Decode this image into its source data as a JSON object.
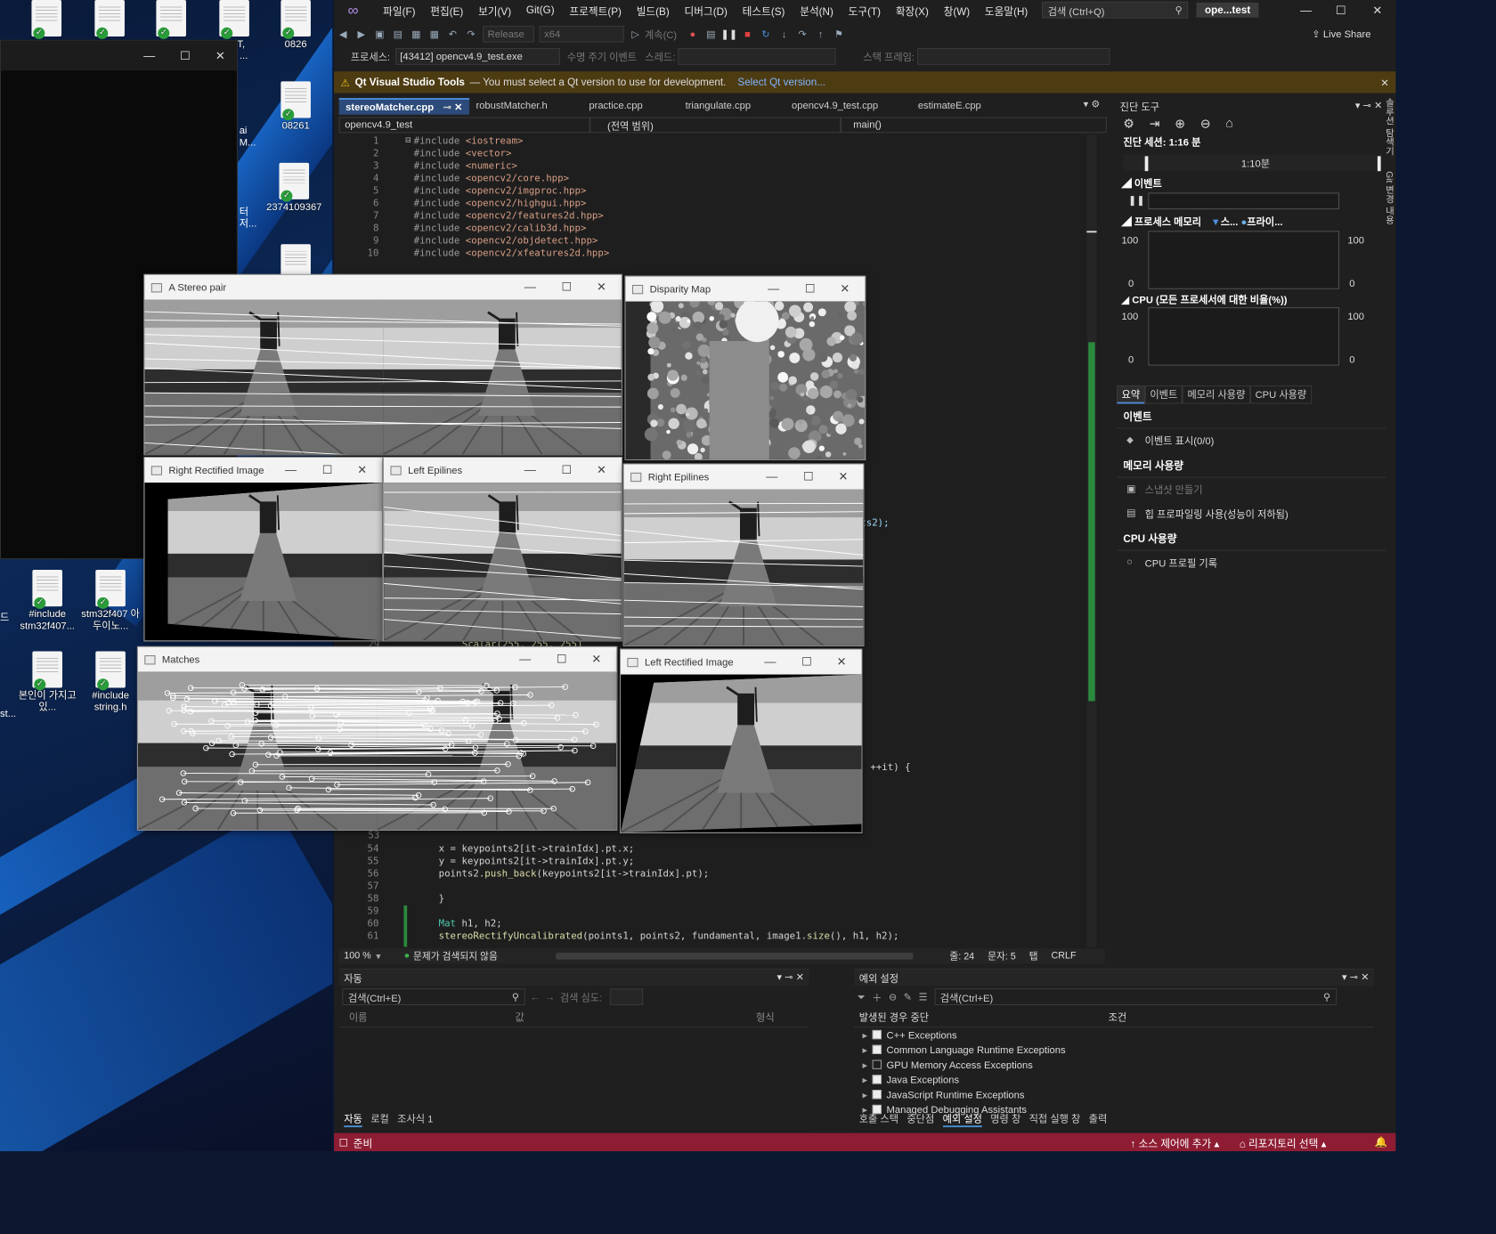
{
  "desktop": {
    "icons": [
      {
        "label": ""
      },
      {
        "label": ""
      },
      {
        "label": ""
      },
      {
        "label": "ART,\nSPI ..."
      },
      {
        "label": "0826"
      },
      {
        "label": "08261"
      },
      {
        "label": "2374109367"
      },
      {
        "label": "#include stm32f407..."
      },
      {
        "label": "stm32f407 아두이노..."
      },
      {
        "label": "본인이 가지고있..."
      },
      {
        "label": "#include string.h"
      }
    ],
    "partial_labels": [
      "ai",
      "M...",
      "터",
      "저...",
      "드",
      "st..."
    ]
  },
  "vs": {
    "menu": [
      "파일(F)",
      "편집(E)",
      "보기(V)",
      "Git(G)",
      "프로젝트(P)",
      "빌드(B)",
      "디버그(D)",
      "테스트(S)",
      "분석(N)",
      "도구(T)",
      "확장(X)",
      "창(W)",
      "도움말(H)"
    ],
    "search_placeholder": "검색 (Ctrl+Q)",
    "solution_title": "ope...test",
    "toolbar": {
      "config": "Release",
      "platform": "x64",
      "continue": "계속(C)",
      "live_share": "Live Share"
    },
    "toolbar2": {
      "process_label": "프로세스:",
      "process_value": "[43412] opencv4.9_test.exe",
      "lifecycle": "수명 주기 이벤트",
      "thread": "스레드:",
      "stack": "스택 프레임:"
    },
    "infobar": {
      "title": "Qt Visual Studio Tools",
      "message": "— You must select a Qt version to use for development.",
      "link": "Select Qt version..."
    },
    "tabs": [
      "stereoMatcher.cpp",
      "robustMatcher.h",
      "practice.cpp",
      "triangulate.cpp",
      "opencv4.9_test.cpp",
      "estimateE.cpp"
    ],
    "nav": {
      "project": "opencv4.9_test",
      "scope": "(전역 범위)",
      "function": "main()"
    },
    "code_top": [
      {
        "n": "1",
        "t": "#include <iostream>"
      },
      {
        "n": "2",
        "t": "#include <vector>"
      },
      {
        "n": "3",
        "t": "#include <numeric>"
      },
      {
        "n": "4",
        "t": "#include <opencv2/core.hpp>"
      },
      {
        "n": "5",
        "t": "#include <opencv2/imgproc.hpp>"
      },
      {
        "n": "6",
        "t": "#include <opencv2/highgui.hpp>"
      },
      {
        "n": "7",
        "t": "#include <opencv2/features2d.hpp>"
      },
      {
        "n": "8",
        "t": "#include <opencv2/calib3d.hpp>"
      },
      {
        "n": "9",
        "t": "#include <opencv2/objdetect.hpp>"
      },
      {
        "n": "10",
        "t": "#include <opencv2/xfeatures2d.hpp>"
      }
    ],
    "code_bottom": [
      {
        "n": "54",
        "t": "x = keypoints2[it->trainIdx].pt.x;"
      },
      {
        "n": "55",
        "t": "y = keypoints2[it->trainIdx].pt.y;"
      },
      {
        "n": "56",
        "t": "points2.push_back(keypoints2[it->trainIdx].pt);"
      },
      {
        "n": "57",
        "t": ""
      },
      {
        "n": "58",
        "t": "}"
      },
      {
        "n": "59",
        "t": ""
      },
      {
        "n": "60",
        "t": "Mat h1, h2;"
      },
      {
        "n": "61",
        "t": "stereoRectifyUncalibrated(points1, points2, fundamental, image1.size(), h1, h2);"
      }
    ],
    "code_fragments": {
      "points2": "points2);",
      "scalar": "Scalar(255, 255, 255)",
      "line29": "29",
      "loop": "nd(); ++it) {",
      "ln53": "53"
    },
    "status_line": {
      "zoom": "100 %",
      "issues": "문제가 검색되지 않음",
      "line": "줄: 24",
      "col": "문자: 5",
      "tab": "탭",
      "eol": "CRLF"
    },
    "diagnostics": {
      "title": "진단 도구",
      "session": "진단 세션: 1:16 분",
      "timeline": "1:10분",
      "events_label": "이벤트",
      "process_mem": "프로세스 메모리",
      "legend1": "스...",
      "legend2": "프라이...",
      "cpu_title": "CPU (모든 프로세서에 대한 비율(%))",
      "axis_top": "100",
      "axis_bottom": "0",
      "subtabs": [
        "요약",
        "이벤트",
        "메모리 사용량",
        "CPU 사용량"
      ],
      "sect_events": "이벤트",
      "show_events": "이벤트 표시(0/0)",
      "sect_mem": "메모리 사용량",
      "snapshot": "스냅샷 만들기",
      "heap": "힙 프로파일링 사용(성능이 저하됨)",
      "sect_cpu": "CPU 사용량",
      "cpu_record": "CPU 프로필 기록"
    },
    "side_labels": [
      "솔루션 탐색기",
      "Git 변경 내용"
    ],
    "autos": {
      "title": "자동",
      "search": "검색(Ctrl+E)",
      "depth": "검색 심도:",
      "cols": [
        "이름",
        "값",
        "형식"
      ],
      "tabs": [
        "자동",
        "로컬",
        "조사식 1"
      ]
    },
    "exceptions": {
      "title": "예외 설정",
      "search": "검색(Ctrl+E)",
      "cols": [
        "발생된 경우 중단",
        "조건"
      ],
      "items": [
        "C++ Exceptions",
        "Common Language Runtime Exceptions",
        "GPU Memory Access Exceptions",
        "Java Exceptions",
        "JavaScript Runtime Exceptions",
        "Managed Debugging Assistants"
      ],
      "tabs": [
        "호출 스택",
        "중단점",
        "예외 설정",
        "명령 창",
        "직접 실행 창",
        "출력"
      ]
    },
    "statusbar": {
      "ready": "준비",
      "source_control": "소스 제어에 추가",
      "repo": "리포지토리 선택"
    }
  },
  "cv_windows": {
    "stereo_pair": "A Stereo pair",
    "disparity": "Disparity Map",
    "right_rect": "Right Rectified Image",
    "left_epi": "Left Epilines",
    "right_epi": "Right Epilines",
    "matches": "Matches",
    "left_rect": "Left Rectified Image"
  },
  "colors": {
    "accent": "#4c8eda",
    "statusbar": "#8e1d33",
    "infobar": "#4d3b12",
    "ok": "#2a9d3a"
  }
}
